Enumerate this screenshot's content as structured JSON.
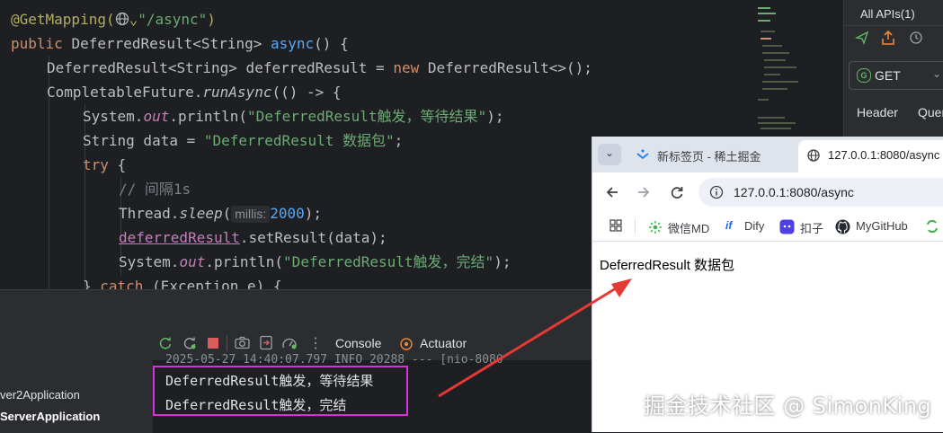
{
  "editor": {
    "lines": {
      "l1_annotation": "@GetMapping(",
      "l1_path": "\"/async\"",
      "l1_close": ")",
      "l2_public": "public ",
      "l2_type": "DeferredResult<String> ",
      "l2_method": "async",
      "l2_rest": "() {",
      "l3_a": "DeferredResult<String> deferredResult = ",
      "l3_new": "new ",
      "l3_b": "DeferredResult<>();",
      "l4_a": "CompletableFuture.",
      "l4_method": "runAsync",
      "l4_b": "(() -> {",
      "l5_a": "System.",
      "l5_out": "out",
      "l5_b": ".println(",
      "l5_str": "\"DeferredResult触发，等待结果\"",
      "l5_c": ");",
      "l6_a": "String data = ",
      "l6_str": "\"DeferredResult 数据包\"",
      "l6_c": ";",
      "l7_try": "try",
      "l7_b": " {",
      "l8_comment": "// 间隔1s",
      "l9_a": "Thread.",
      "l9_sleep": "sleep",
      "l9_b": "(",
      "l9_hint": "millis:",
      "l9_num": "2000",
      "l9_c": ");",
      "l10_var": "deferredResult",
      "l10_b": ".setResult(data);",
      "l11_a": "System.",
      "l11_out": "out",
      "l11_b": ".println(",
      "l11_str": "\"DeferredResult触发，完结\"",
      "l11_c": ");",
      "l12_a": "} ",
      "l12_catch": "catch",
      "l12_b": " (Exception e) {"
    }
  },
  "api_panel": {
    "title": "All APIs(1)",
    "method": "GET",
    "tabs": [
      "Header",
      "Quer"
    ]
  },
  "run_panel": {
    "tabs": {
      "console": "Console",
      "actuator": "Actuator"
    },
    "more": "⋮",
    "apps": [
      "ver2Application",
      "ServerApplication"
    ],
    "log_partial": "2025-05-27 14:40:07.797  INFO 20288 --- [nio-8080",
    "output": [
      "DeferredResult触发，等待结果",
      "DeferredResult触发，完结"
    ]
  },
  "browser": {
    "tabs": [
      {
        "label": "新标签页 - 稀土掘金"
      },
      {
        "label": "127.0.0.1:8080/async"
      }
    ],
    "address": "127.0.0.1:8080/async",
    "bookmarks": [
      "微信MD",
      "Dify",
      "扣子",
      "MyGitHub"
    ],
    "body_text": "DeferredResult 数据包"
  },
  "watermark": "掘金技术社区 @ SimonKing",
  "colors": {
    "highlight_box": "#d633d6",
    "arrow": "#e53935",
    "accent_orange": "#f0883e",
    "run_green": "#5fb865"
  }
}
